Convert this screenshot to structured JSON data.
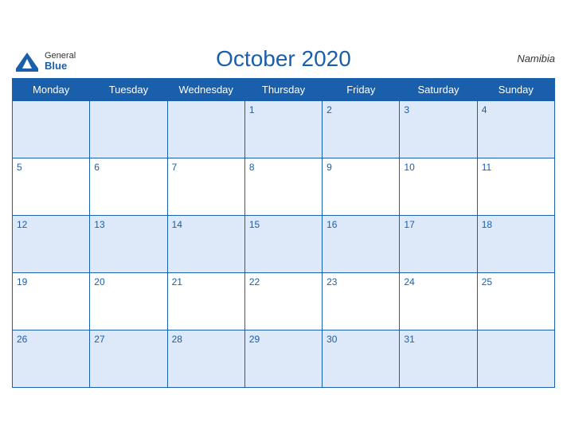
{
  "brand": {
    "general": "General",
    "blue": "Blue"
  },
  "title": "October 2020",
  "country": "Namibia",
  "weekdays": [
    "Monday",
    "Tuesday",
    "Wednesday",
    "Thursday",
    "Friday",
    "Saturday",
    "Sunday"
  ],
  "weeks": [
    [
      null,
      null,
      null,
      1,
      2,
      3,
      4
    ],
    [
      5,
      6,
      7,
      8,
      9,
      10,
      11
    ],
    [
      12,
      13,
      14,
      15,
      16,
      17,
      18
    ],
    [
      19,
      20,
      21,
      22,
      23,
      24,
      25
    ],
    [
      26,
      27,
      28,
      29,
      30,
      31,
      null
    ]
  ]
}
